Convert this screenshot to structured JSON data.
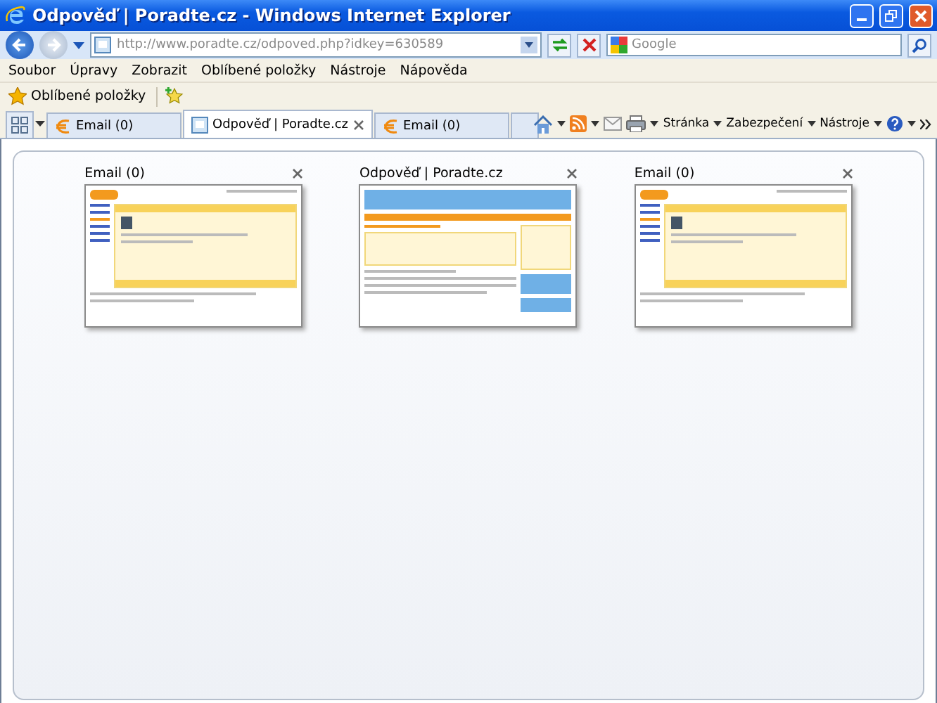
{
  "window": {
    "title": "Odpověď | Poradte.cz - Windows Internet Explorer"
  },
  "address": {
    "url": "http://www.poradte.cz/odpoved.php?idkey=630589"
  },
  "search": {
    "placeholder": "Google"
  },
  "menu": [
    "Soubor",
    "Úpravy",
    "Zobrazit",
    "Oblíbené položky",
    "Nástroje",
    "Nápověda"
  ],
  "favorites_bar": {
    "label": "Oblíbené položky"
  },
  "tabs": [
    {
      "label": "Email (0)",
      "selected": false
    },
    {
      "label": "Odpověď | Poradte.cz",
      "selected": true
    },
    {
      "label": "Email (0)",
      "selected": false
    }
  ],
  "commands": [
    "Stránka",
    "Zabezpečení",
    "Nástroje"
  ],
  "quick_tabs": [
    {
      "title": "Email (0)",
      "kind": "email"
    },
    {
      "title": "Odpověď | Poradte.cz",
      "kind": "forum"
    },
    {
      "title": "Email (0)",
      "kind": "email"
    }
  ]
}
